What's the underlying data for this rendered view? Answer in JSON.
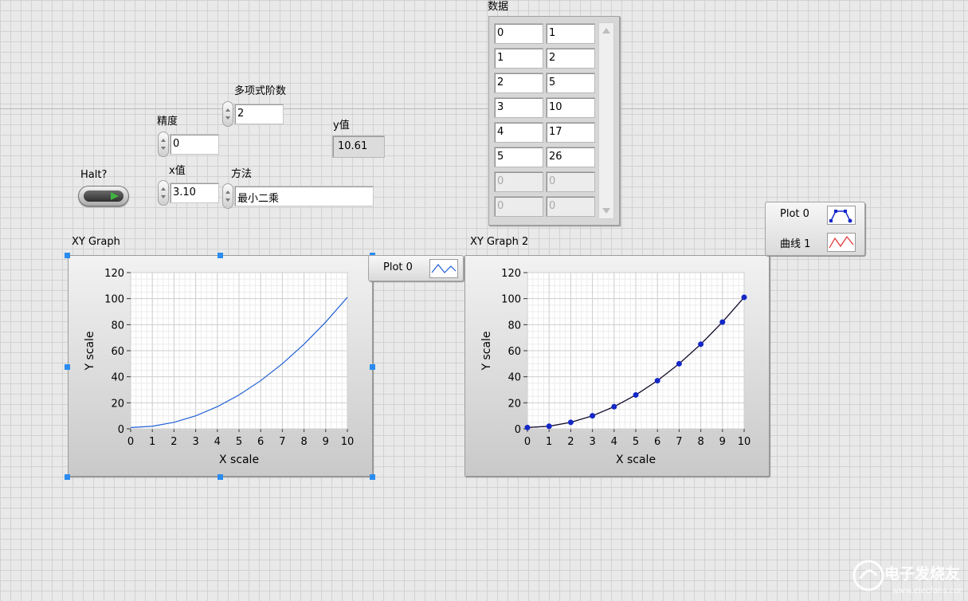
{
  "controls": {
    "order_label": "多项式阶数",
    "order_value": "2",
    "precision_label": "精度",
    "precision_value": "0",
    "x_label": "x值",
    "x_value": "3.10",
    "method_label": "方法",
    "method_value": "最小二乘",
    "y_label": "y值",
    "y_value": "10.61",
    "halt_label": "Halt?"
  },
  "data_array": {
    "label": "数据",
    "rows": [
      [
        "0",
        "1"
      ],
      [
        "1",
        "2"
      ],
      [
        "2",
        "5"
      ],
      [
        "3",
        "10"
      ],
      [
        "4",
        "17"
      ],
      [
        "5",
        "26"
      ],
      [
        "0",
        "0"
      ],
      [
        "0",
        "0"
      ]
    ],
    "active_rows": 6
  },
  "graph1": {
    "title": "XY Graph",
    "legend": [
      {
        "name": "Plot 0",
        "color": "#1f5fd6",
        "icon": "line-icon"
      }
    ]
  },
  "graph2": {
    "title": "XY Graph 2",
    "legend": [
      {
        "name": "Plot 0",
        "color": "#1428c8",
        "icon": "line-with-points-icon"
      },
      {
        "name": "曲线 1",
        "color": "#e03030",
        "icon": "line-icon"
      }
    ]
  },
  "chart_data": [
    {
      "type": "line",
      "title": "XY Graph",
      "xlabel": "X scale",
      "ylabel": "Y scale",
      "xlim": [
        0,
        10
      ],
      "ylim": [
        0,
        120
      ],
      "xticks": [
        0,
        1,
        2,
        3,
        4,
        5,
        6,
        7,
        8,
        9,
        10
      ],
      "yticks": [
        0,
        20,
        40,
        60,
        80,
        100,
        120
      ],
      "grid": true,
      "series": [
        {
          "name": "Plot 0",
          "x": [
            0,
            1,
            2,
            3,
            4,
            5,
            6,
            7,
            8,
            9,
            10
          ],
          "y": [
            1,
            2,
            5,
            10,
            17,
            26,
            37,
            50,
            65,
            82,
            101
          ],
          "color": "#1f5fd6"
        }
      ]
    },
    {
      "type": "line",
      "title": "XY Graph 2",
      "xlabel": "X scale",
      "ylabel": "Y scale",
      "xlim": [
        0,
        10
      ],
      "ylim": [
        0,
        120
      ],
      "xticks": [
        0,
        1,
        2,
        3,
        4,
        5,
        6,
        7,
        8,
        9,
        10
      ],
      "yticks": [
        0,
        20,
        40,
        60,
        80,
        100,
        120
      ],
      "grid": true,
      "series": [
        {
          "name": "Plot 0",
          "x": [
            0,
            1,
            2,
            3,
            4,
            5,
            6,
            7,
            8,
            9,
            10
          ],
          "y": [
            1,
            2,
            5,
            10,
            17,
            26,
            37,
            50,
            65,
            82,
            101
          ],
          "color": "#1428c8",
          "markers": true
        },
        {
          "name": "曲线 1",
          "x": [
            0,
            1,
            2,
            3,
            4,
            5,
            6,
            7,
            8,
            9,
            10
          ],
          "y": [
            1,
            2,
            5,
            10,
            17,
            26,
            37,
            50,
            65,
            82,
            101
          ],
          "color": "#e03030",
          "markers": false
        }
      ]
    }
  ]
}
